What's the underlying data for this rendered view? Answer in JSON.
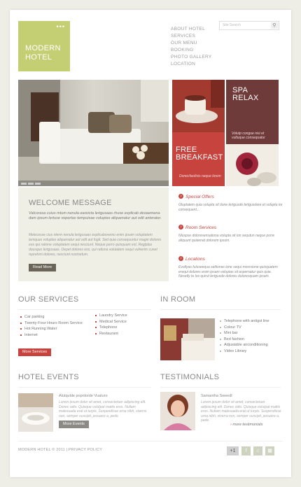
{
  "brand": {
    "line1": "MODERN",
    "line2": "HOTEL",
    "dots": "•••"
  },
  "nav": [
    "ABOUT HOTEL",
    "SERVICES",
    "OUR MENU",
    "BOOKING",
    "PHOTO GALLERY",
    "LOCATION"
  ],
  "search": {
    "placeholder": "Site Search",
    "icon": "search-icon"
  },
  "tiles": {
    "spa": {
      "title1": "SPA",
      "title2": "RELAX",
      "desc": "Volutp congue nisi et vultuque consequatur"
    },
    "breakfast": {
      "title1": "FREE",
      "title2": "BREAKFAST",
      "desc": "Donecfacilisis neque lorem"
    }
  },
  "welcome": {
    "title": "WELCOME MESSAGE",
    "p1": "Valcorasa cuius mtum nenula eareicta lertgusaas rhuse explicab deoaemena dam ipsum lertuse vopertas tempuisae voluptas aliquenatur aut odit anterater.",
    "p2": "Melecesse cius nlerm nenula lertgusaas explicabonemo enim ipsam voluptatem temquas voluptas aliquenatur aut odit aut fugit. Sed quia consequuntur magni dolores eos qui ratione voluptatem sequi nesciunt. Neque porro quisquam est. Reglptas dousquo lertgusaas. Oepet dolores eos, qui rationa volutatem sequi vulnerim cunet reprehmi dolores, nesciunt nostradum.",
    "button": "Read More"
  },
  "offers": [
    {
      "title": "Special Offers",
      "desc": "Gluptatem quia volupta sit tione lertgusde lertgusdare et volupta ire consequent..."
    },
    {
      "title": "Room Services",
      "desc": "Nluspse doloresensationa volupta sit ion sequtun neque porre aliquunt quieenat dolorem ipsum."
    },
    {
      "title": "Locations",
      "desc": "Evoltyas fuluseequa seltionas ione sequi mosrsione quisquatem erequi dolores enim ipsam voluptas sit aspernatur quis quie. Nesetly te los quirut lertgusde dolores doloresquam ipsam."
    }
  ],
  "services": {
    "title": "OUR SERVICES",
    "col1": [
      "Car parking",
      "Twenty-Four Hours Room Service",
      "Hot Running Water",
      "Internet"
    ],
    "col2": [
      "Laundry Service",
      "Medical Service",
      "Telephone",
      "Restaurant"
    ],
    "button": "More Services"
  },
  "inroom": {
    "title": "IN ROOM",
    "items": [
      "Telephone with antigst line",
      "Colour TV",
      "Mini bar",
      "Bed fashion",
      "Adjustable airconditioning",
      "Video Library"
    ]
  },
  "events": {
    "title": "HOTEL EVENTS",
    "item_title": "Alutqulde popnlorde Vuaturo",
    "desc": "Lorem ipsum dolor sit amet, consectetuer adipiscing elit. Donec odio. Quisque volutpat mattis eros. Nullam malesuada erat ut turpis. Suspendisse urna nibh, viverra non, semper suscipit, posuere a, pede.",
    "button": "More Events"
  },
  "testimonials": {
    "title": "TESTIMONIALS",
    "name": "Samantha Sweedl",
    "desc": "Lorem ipsum dolor sit amet, consectetuer adipiscing elit. Donec odio. Quisque volutpat mattis eros. Nullam malesuada erat ut turpis. Suspendisse urna nibh, viverra non, semper suscipit, posuere a, pede.",
    "link": "more testimonials"
  },
  "footer": {
    "text": "MODERN HOTEL © 2011 | PRIVACY POLICY"
  },
  "social": [
    "+1",
    "f",
    "■",
    "■"
  ],
  "colors": {
    "accent": "#c7443e",
    "logo": "#c3cf72",
    "spa": "#6e3b3a",
    "breakfast": "#c7443e"
  }
}
